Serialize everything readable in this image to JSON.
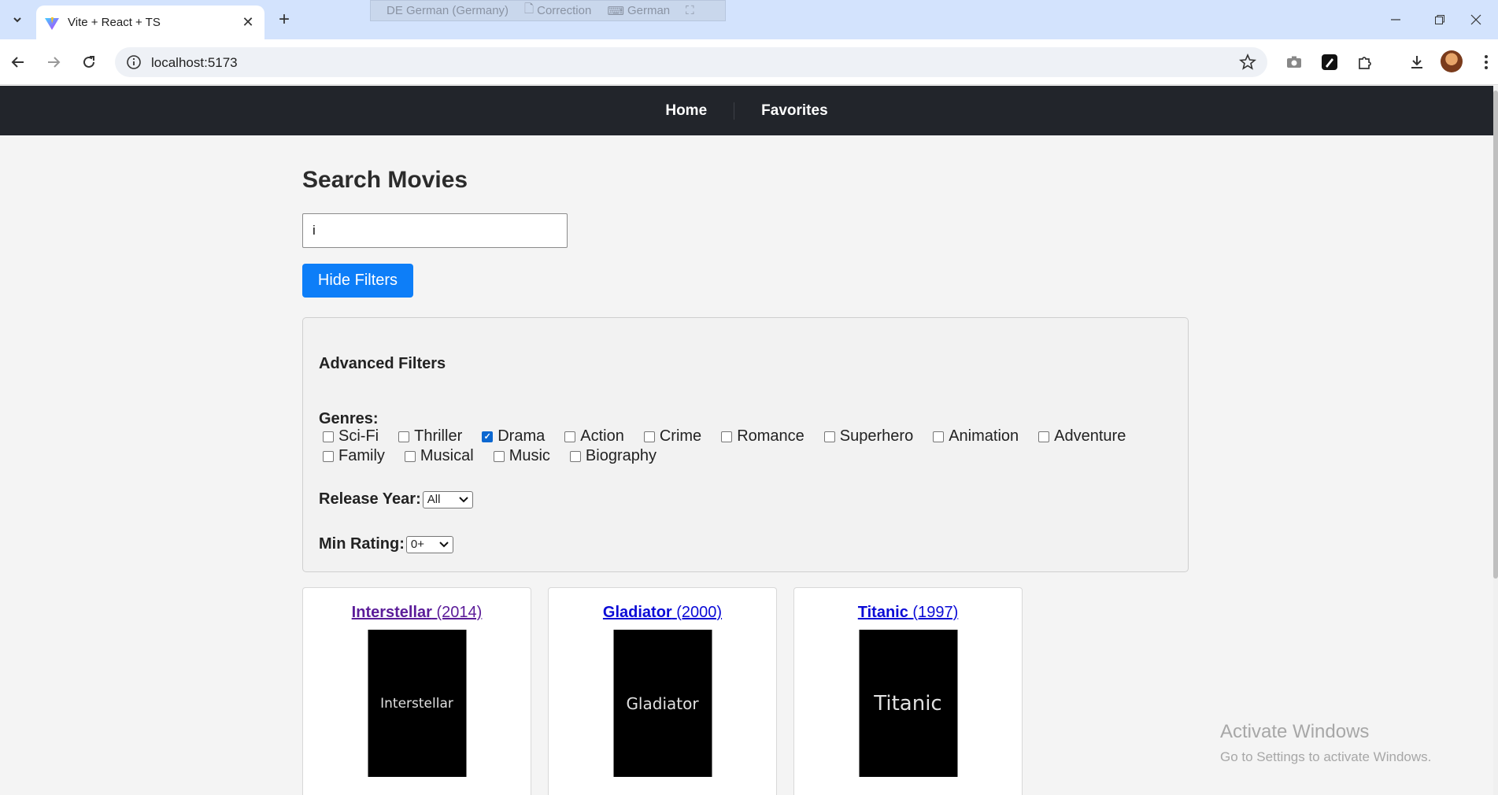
{
  "browser": {
    "tab_title": "Vite + React + TS",
    "url": "localhost:5173",
    "ime": [
      "DE German (Germany)",
      "Correction",
      "German"
    ]
  },
  "nav": {
    "home": "Home",
    "favorites": "Favorites"
  },
  "page": {
    "title": "Search Movies",
    "search_value": "i",
    "hide_filters_label": "Hide Filters"
  },
  "filters": {
    "title": "Advanced Filters",
    "genres_label": "Genres:",
    "genres": [
      {
        "label": "Sci-Fi",
        "checked": false
      },
      {
        "label": "Thriller",
        "checked": false
      },
      {
        "label": "Drama",
        "checked": true
      },
      {
        "label": "Action",
        "checked": false
      },
      {
        "label": "Crime",
        "checked": false
      },
      {
        "label": "Romance",
        "checked": false
      },
      {
        "label": "Superhero",
        "checked": false
      },
      {
        "label": "Animation",
        "checked": false
      },
      {
        "label": "Adventure",
        "checked": false
      },
      {
        "label": "Family",
        "checked": false
      },
      {
        "label": "Musical",
        "checked": false
      },
      {
        "label": "Music",
        "checked": false
      },
      {
        "label": "Biography",
        "checked": false
      }
    ],
    "year_label": "Release Year:",
    "year_value": "All",
    "rating_label": "Min Rating:",
    "rating_value": "0+"
  },
  "movies": [
    {
      "name": "Interstellar",
      "year": "(2014)",
      "poster_text": "Interstellar",
      "visited": true
    },
    {
      "name": "Gladiator",
      "year": "(2000)",
      "poster_text": "Gladiator",
      "visited": false
    },
    {
      "name": "Titanic",
      "year": "(1997)",
      "poster_text": "Titanic",
      "visited": false
    }
  ],
  "watermark": {
    "line1": "Activate Windows",
    "line2": "Go to Settings to activate Windows."
  }
}
